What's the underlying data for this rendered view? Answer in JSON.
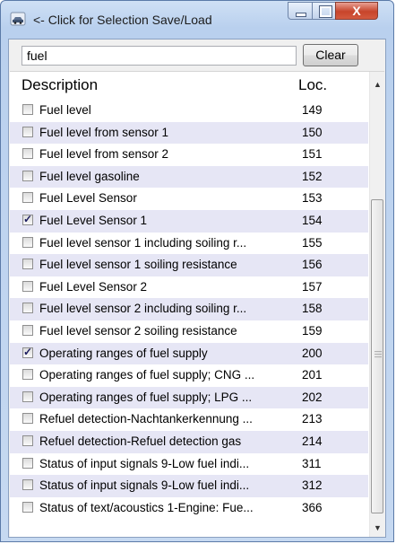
{
  "window": {
    "title": "<- Click for Selection Save/Load",
    "icons": {
      "app": "car-icon",
      "minimize": "minimize-icon",
      "maximize": "maximize-icon",
      "close": "close-icon"
    },
    "close_glyph": "X"
  },
  "search": {
    "value": "fuel",
    "clear_label": "Clear"
  },
  "table": {
    "columns": {
      "description": "Description",
      "loc": "Loc."
    },
    "rows": [
      {
        "description": "Fuel level",
        "loc": "149",
        "checked": false
      },
      {
        "description": "Fuel level from sensor 1",
        "loc": "150",
        "checked": false
      },
      {
        "description": "Fuel level from sensor 2",
        "loc": "151",
        "checked": false
      },
      {
        "description": "Fuel level gasoline",
        "loc": "152",
        "checked": false
      },
      {
        "description": "Fuel Level Sensor",
        "loc": "153",
        "checked": false
      },
      {
        "description": "Fuel Level Sensor 1",
        "loc": "154",
        "checked": true
      },
      {
        "description": "Fuel level sensor 1 including soiling r...",
        "loc": "155",
        "checked": false
      },
      {
        "description": "Fuel level sensor 1 soiling resistance",
        "loc": "156",
        "checked": false
      },
      {
        "description": "Fuel Level Sensor 2",
        "loc": "157",
        "checked": false
      },
      {
        "description": "Fuel level sensor 2 including soiling r...",
        "loc": "158",
        "checked": false
      },
      {
        "description": "Fuel level sensor 2 soiling resistance",
        "loc": "159",
        "checked": false
      },
      {
        "description": "Operating ranges of fuel supply",
        "loc": "200",
        "checked": true
      },
      {
        "description": "Operating ranges of fuel supply; CNG ...",
        "loc": "201",
        "checked": false
      },
      {
        "description": "Operating ranges of fuel supply; LPG ...",
        "loc": "202",
        "checked": false
      },
      {
        "description": "Refuel detection-Nachtankerkennung ...",
        "loc": "213",
        "checked": false
      },
      {
        "description": "Refuel detection-Refuel detection gas",
        "loc": "214",
        "checked": false
      },
      {
        "description": "Status of input signals 9-Low fuel indi...",
        "loc": "311",
        "checked": false
      },
      {
        "description": "Status of input signals 9-Low fuel indi...",
        "loc": "312",
        "checked": false
      },
      {
        "description": "Status of text/acoustics 1-Engine: Fue...",
        "loc": "366",
        "checked": false
      }
    ]
  },
  "scrollbar": {
    "up_icon": "scroll-up-icon",
    "down_icon": "scroll-down-icon",
    "up_glyph": "▲",
    "down_glyph": "▼"
  }
}
